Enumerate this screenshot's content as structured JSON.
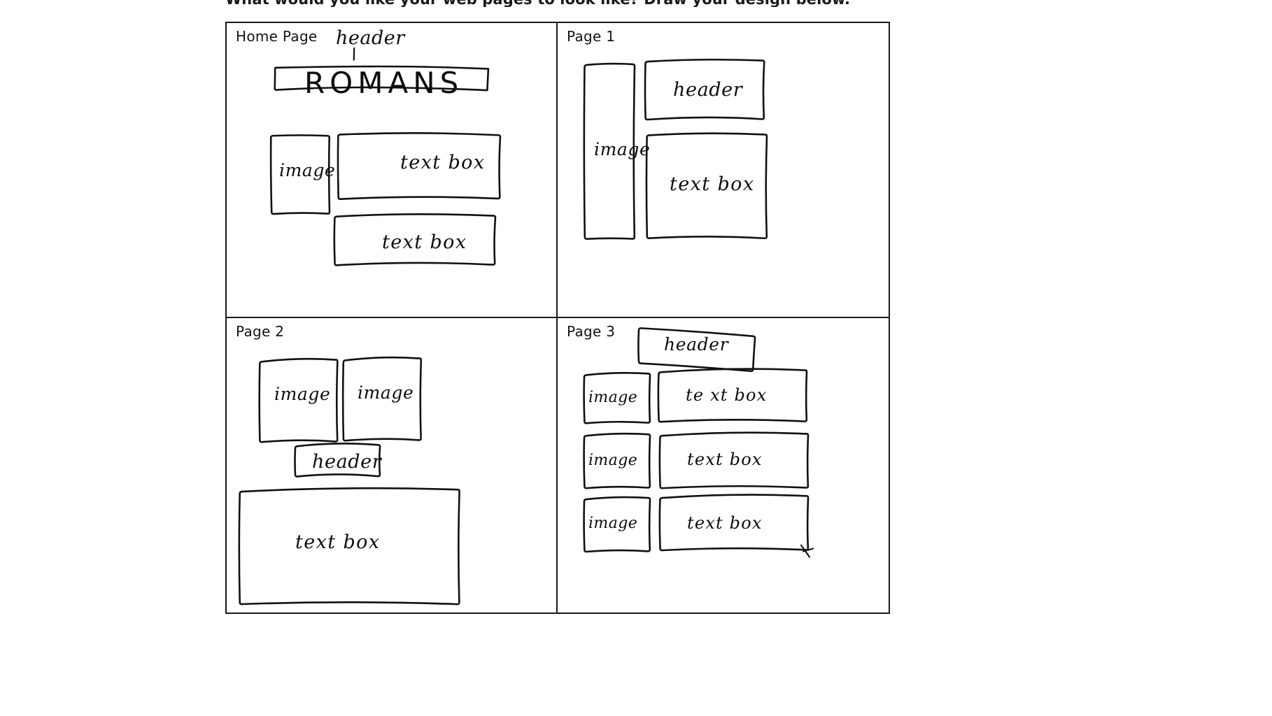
{
  "prompt": {
    "question": "What would you like your web pages to look like?  Draw your design below."
  },
  "sketch": {
    "ink_color": "#111111",
    "paper_color": "#ffffff",
    "quadrants": [
      {
        "id": "home-page",
        "label": "Home Page",
        "annotations": [
          {
            "name": "header-annotation",
            "text": "header",
            "style": "handwritten-pointer"
          }
        ],
        "blocks": [
          {
            "name": "banner-box",
            "text": "ROMANS",
            "kind": "header-banner"
          },
          {
            "name": "image-box",
            "text": "image",
            "kind": "image"
          },
          {
            "name": "text-box-1",
            "text": "text box",
            "kind": "text"
          },
          {
            "name": "text-box-2",
            "text": "text box",
            "kind": "text"
          }
        ]
      },
      {
        "id": "page-1",
        "label": "Page 1",
        "annotations": [],
        "blocks": [
          {
            "name": "image-box",
            "text": "image",
            "kind": "image"
          },
          {
            "name": "header-box",
            "text": "header",
            "kind": "header"
          },
          {
            "name": "text-box",
            "text": "text box",
            "kind": "text"
          }
        ]
      },
      {
        "id": "page-2",
        "label": "Page 2",
        "annotations": [],
        "blocks": [
          {
            "name": "image-box-left",
            "text": "image",
            "kind": "image"
          },
          {
            "name": "image-box-right",
            "text": "image",
            "kind": "image"
          },
          {
            "name": "header-box",
            "text": "header",
            "kind": "header"
          },
          {
            "name": "text-box",
            "text": "text box",
            "kind": "text"
          }
        ]
      },
      {
        "id": "page-3",
        "label": "Page 3",
        "annotations": [],
        "blocks": [
          {
            "name": "header-box",
            "text": "header",
            "kind": "header"
          },
          {
            "name": "image-box-1",
            "text": "image",
            "kind": "image"
          },
          {
            "name": "text-box-1",
            "text": "te xt box",
            "kind": "text"
          },
          {
            "name": "image-box-2",
            "text": "image",
            "kind": "image"
          },
          {
            "name": "text-box-2",
            "text": "text box",
            "kind": "text"
          },
          {
            "name": "image-box-3",
            "text": "image",
            "kind": "image"
          },
          {
            "name": "text-box-3",
            "text": "text box",
            "kind": "text"
          }
        ]
      }
    ]
  }
}
